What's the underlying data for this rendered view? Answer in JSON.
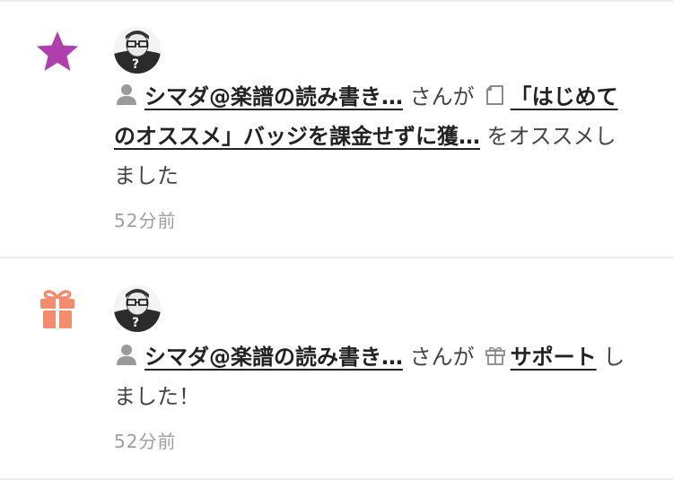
{
  "notifications": [
    {
      "type": "recommend",
      "type_icon": "star-icon",
      "type_icon_color": "#b03fae",
      "avatar_icon": "user-avatar",
      "user_icon": "person-icon",
      "user_name": "シマダ@楽譜の読み書き…",
      "connector": "さんが",
      "target_icon": "note-icon",
      "target_title": "「はじめてのオススメ」バッジを課金せずに獲…",
      "action": "をオススメしました",
      "time": "52分前"
    },
    {
      "type": "support",
      "type_icon": "gift-icon",
      "type_icon_color": "#f28c6d",
      "avatar_icon": "user-avatar",
      "user_icon": "person-icon",
      "user_name": "シマダ@楽譜の読み書き…",
      "connector": "さんが",
      "target_icon": "gift-outline-icon",
      "target_title": "サポート",
      "action": "しました！",
      "time": "52分前"
    }
  ],
  "colors": {
    "divider": "#ececec",
    "time": "#9e9e9e",
    "link": "#222222"
  }
}
